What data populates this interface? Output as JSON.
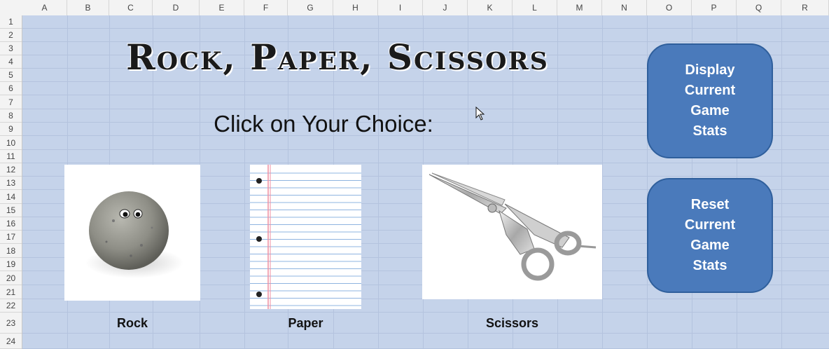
{
  "columns": [
    "A",
    "B",
    "C",
    "D",
    "E",
    "F",
    "G",
    "H",
    "I",
    "J",
    "K",
    "L",
    "M",
    "N",
    "O",
    "P",
    "Q",
    "R"
  ],
  "rows": [
    "1",
    "2",
    "3",
    "4",
    "5",
    "6",
    "7",
    "8",
    "9",
    "10",
    "11",
    "12",
    "13",
    "14",
    "15",
    "16",
    "17",
    "18",
    "19",
    "20",
    "21",
    "22",
    "23",
    "24"
  ],
  "title": "Rock, Paper, Scissors",
  "subtitle": "Click on Your Choice:",
  "choices": [
    {
      "label": "Rock",
      "icon": "rock-image"
    },
    {
      "label": "Paper",
      "icon": "paper-image"
    },
    {
      "label": "Scissors",
      "icon": "scissors-image"
    }
  ],
  "buttons": {
    "display_stats": "Display\nCurrent\nGame\nStats",
    "reset_stats": "Reset\nCurrent\nGame\nStats"
  },
  "colors": {
    "sheet_background": "#c5d3ea",
    "button_fill": "#4a7abb",
    "button_border": "#2f5f9c"
  }
}
